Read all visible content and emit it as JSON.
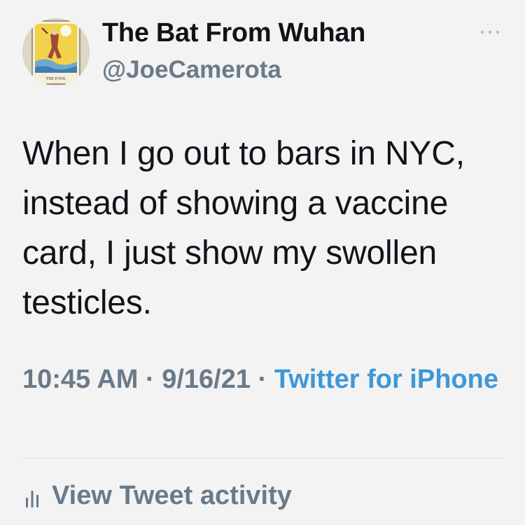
{
  "author": {
    "display_name": "The Bat From Wuhan",
    "handle": "@JoeCamerota",
    "avatar_caption": "THE FOOL"
  },
  "more_icon": "more-horizontal-icon",
  "tweet": {
    "text": "When I go out to bars in NYC, instead of showing a vaccine card, I just show my swollen testicles."
  },
  "meta": {
    "time": "10:45 AM",
    "separator": " · ",
    "date": "9/16/21",
    "source": "Twitter for iPhone"
  },
  "activity": {
    "icon": "bar-chart-icon",
    "label": "View Tweet activity"
  },
  "colors": {
    "background": "#f3f3f4",
    "text_primary": "#0f1419",
    "text_secondary": "#6a7a88",
    "link": "#3f97d8",
    "divider": "#d5d9dc"
  }
}
